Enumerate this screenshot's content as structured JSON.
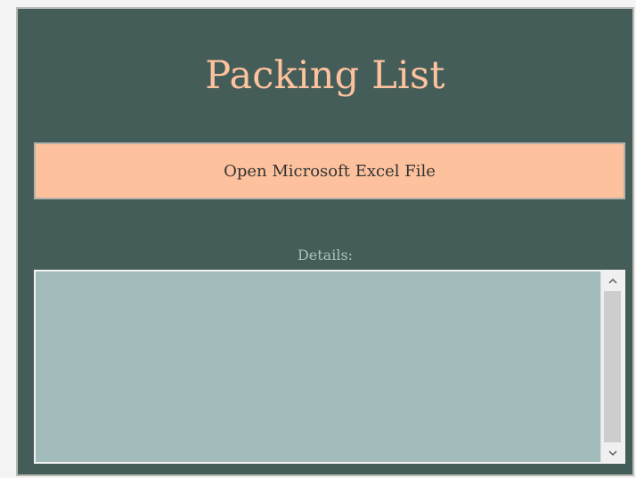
{
  "window": {
    "title": "Packing List"
  },
  "actions": {
    "open_button_label": "Open Microsoft Excel File"
  },
  "details": {
    "label": "Details:",
    "content": ""
  },
  "icons": {
    "scroll_up": "chevron-up-icon",
    "scroll_down": "chevron-down-icon"
  },
  "colors": {
    "background": "#455d59",
    "title": "#fec39e",
    "button": "#fdc29d",
    "details_box": "#a2bcbb",
    "details_label": "#a9c1bd"
  }
}
